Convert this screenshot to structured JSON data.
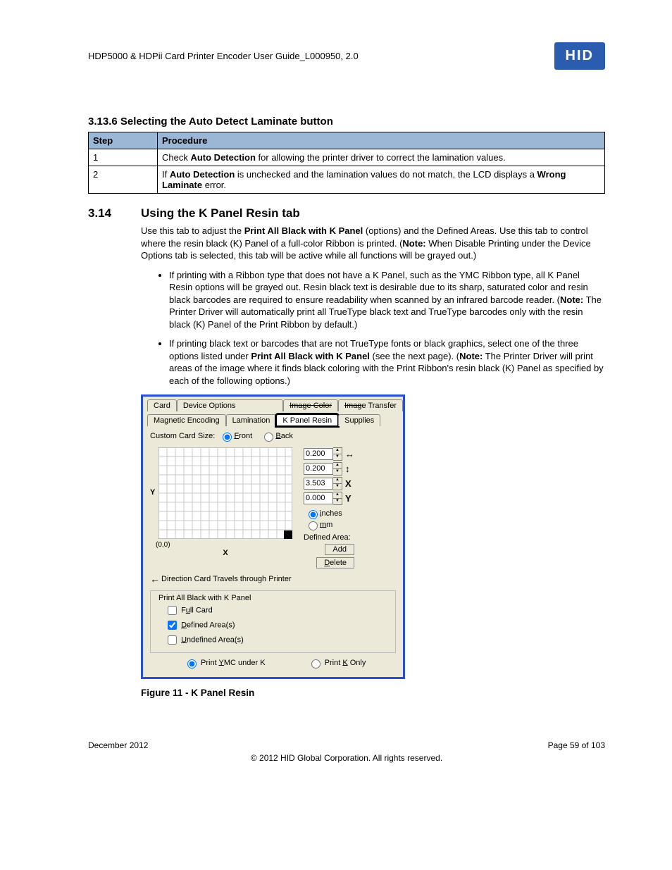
{
  "header": {
    "doc_title": "HDP5000 & HDPii Card Printer Encoder User Guide_L000950, 2.0",
    "logo_text": "HID"
  },
  "section_3_13_6": {
    "number": "3.13.6",
    "title": "Selecting the Auto Detect Laminate button",
    "col_step": "Step",
    "col_proc": "Procedure",
    "rows": [
      {
        "step": "1",
        "proc_a": "Check ",
        "proc_b": "Auto Detection",
        "proc_c": " for allowing the printer driver to correct the lamination values."
      },
      {
        "step": "2",
        "proc_a": "If ",
        "proc_b": "Auto Detection",
        "proc_c": " is unchecked and the lamination values do not match, the LCD displays a ",
        "proc_d": "Wrong Laminate",
        "proc_e": " error."
      }
    ]
  },
  "section_3_14": {
    "number": "3.14",
    "title": "Using the K Panel Resin tab",
    "para": {
      "a": "Use this tab to adjust the ",
      "b": "Print All Black with K Panel",
      "c": " (options) and the Defined Areas. Use this tab to control where the resin black (K) Panel of a full-color Ribbon is printed. (",
      "d": "Note:",
      "e": "  When Disable Printing under the Device Options tab is selected, this tab will be active while all functions will be grayed out.)"
    },
    "bullets": [
      {
        "a": "If printing with a Ribbon type that does not have a K Panel, such as the YMC Ribbon type, all K Panel Resin options will be grayed out. Resin black text is desirable due to its sharp, saturated color and resin black barcodes are required to ensure readability when scanned by an infrared barcode reader. (",
        "b": "Note:",
        "c": "  The Printer Driver will automatically print all TrueType black text and TrueType barcodes only with the resin black (K) Panel of the Print Ribbon by default.)"
      },
      {
        "a": "If printing black text or barcodes that are not TrueType fonts or black graphics, select one of the three options listed under ",
        "b": "Print All Black with K Panel",
        "c": " (see the next page). (",
        "d": "Note:",
        "e": " The Printer Driver will print areas of the image where it finds black coloring with the Print Ribbon's resin black (K) Panel as specified by each of the following options.)"
      }
    ],
    "figure_caption": "Figure 11 - K Panel Resin"
  },
  "dialog": {
    "tabs_row1": [
      "Card",
      "Device Options",
      "Image Color",
      "Image Transfer"
    ],
    "tabs_row2": [
      "Magnetic Encoding",
      "Lamination",
      "K Panel Resin",
      "Supplies"
    ],
    "active_tab": "K Panel Resin",
    "custom_card_label": "Custom Card Size:",
    "front": "Front",
    "back": "Back",
    "grid_y": "Y",
    "grid_x": "X",
    "grid_origin": "(0,0)",
    "dims": [
      {
        "val": "0.200",
        "icon": "↔"
      },
      {
        "val": "0.200",
        "icon": "↕"
      },
      {
        "val": "3.503",
        "icon": "X"
      },
      {
        "val": "0.000",
        "icon": "Y"
      }
    ],
    "unit_inches": "inches",
    "unit_mm": "mm",
    "defined_area": "Defined Area:",
    "btn_add": "Add",
    "btn_delete": "Delete",
    "direction_text": "Direction Card Travels through Printer",
    "group_title": "Print All Black with K Panel",
    "chk_full": "Full Card",
    "chk_def": "Defined Area(s)",
    "chk_undef": "Undefined Area(s)",
    "opt_ymc": "Print YMC under K",
    "opt_konly": "Print K Only"
  },
  "footer": {
    "date": "December 2012",
    "page": "Page 59 of 103",
    "copyright": "© 2012 HID Global Corporation. All rights reserved."
  }
}
